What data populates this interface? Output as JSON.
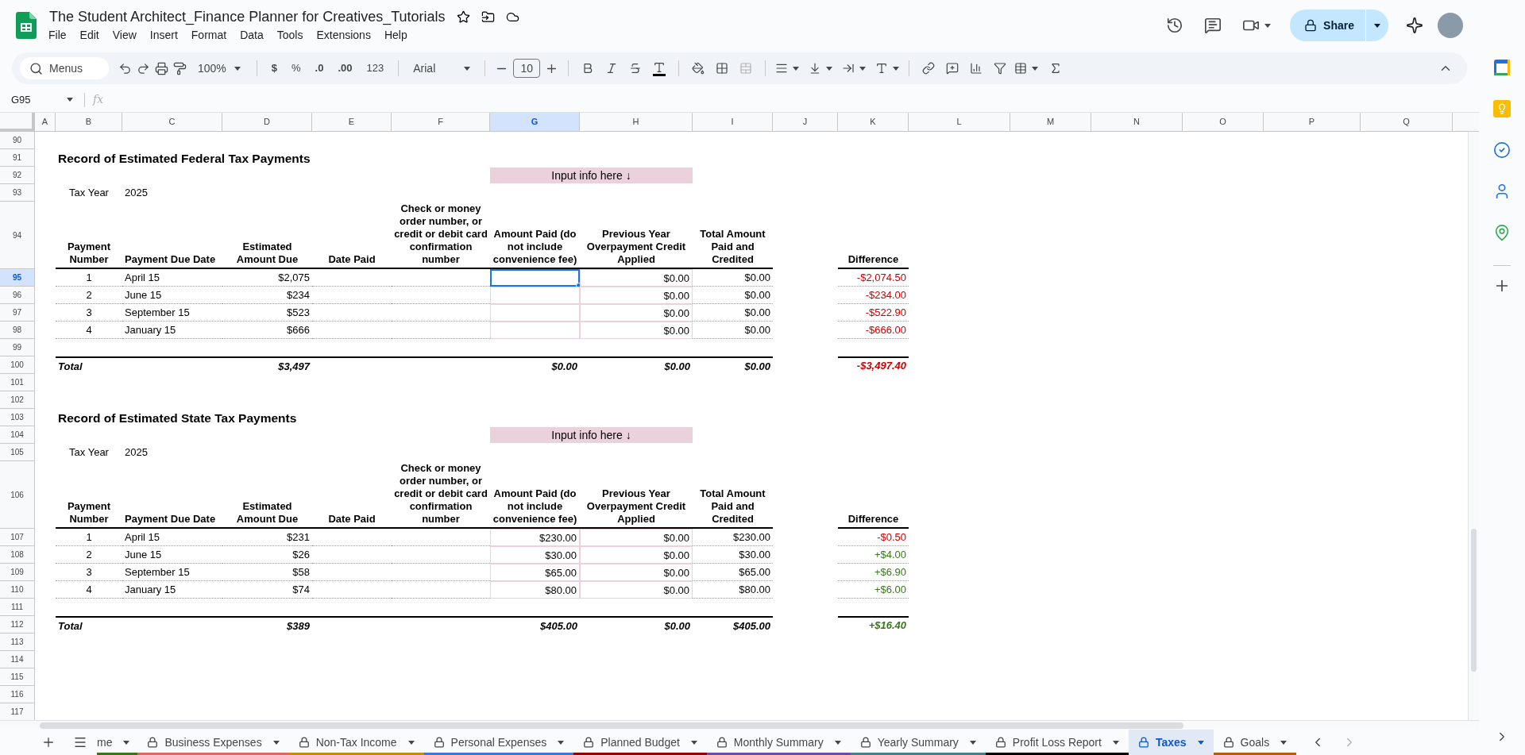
{
  "document": {
    "title": "The Student Architect_Finance Planner for Creatives_Tutorials",
    "menus": [
      "File",
      "Edit",
      "View",
      "Insert",
      "Format",
      "Data",
      "Tools",
      "Extensions",
      "Help"
    ]
  },
  "share_button": {
    "label": "Share"
  },
  "toolbar": {
    "search": "Menus",
    "zoom": "100%",
    "currency": "$",
    "percent": "%",
    "decrease_decimals": ".0",
    "increase_decimals": ".00",
    "number_format": "123",
    "font": "Arial",
    "font_size": "10"
  },
  "formula_bar": {
    "name_box": "G95",
    "function_label": "fx"
  },
  "columns": [
    {
      "label": "A",
      "selected": false
    },
    {
      "label": "B",
      "selected": false
    },
    {
      "label": "C",
      "selected": false
    },
    {
      "label": "D",
      "selected": false
    },
    {
      "label": "E",
      "selected": false
    },
    {
      "label": "F",
      "selected": false
    },
    {
      "label": "G",
      "selected": true
    },
    {
      "label": "H",
      "selected": false
    },
    {
      "label": "I",
      "selected": false
    },
    {
      "label": "J",
      "selected": false
    },
    {
      "label": "K",
      "selected": false
    },
    {
      "label": "L",
      "selected": false
    },
    {
      "label": "M",
      "selected": false
    },
    {
      "label": "N",
      "selected": false
    },
    {
      "label": "O",
      "selected": false
    },
    {
      "label": "P",
      "selected": false
    },
    {
      "label": "Q",
      "selected": false
    }
  ],
  "row_numbers": [
    {
      "label": "90",
      "selected": false
    },
    {
      "label": "91",
      "selected": false
    },
    {
      "label": "92",
      "selected": false
    },
    {
      "label": "93",
      "selected": false
    },
    {
      "label": "94",
      "selected": false
    },
    {
      "label": "95",
      "selected": true
    },
    {
      "label": "96",
      "selected": false
    },
    {
      "label": "97",
      "selected": false
    },
    {
      "label": "98",
      "selected": false
    },
    {
      "label": "99",
      "selected": false
    },
    {
      "label": "100",
      "selected": false
    },
    {
      "label": "101",
      "selected": false
    },
    {
      "label": "102",
      "selected": false
    },
    {
      "label": "103",
      "selected": false
    },
    {
      "label": "104",
      "selected": false
    },
    {
      "label": "105",
      "selected": false
    },
    {
      "label": "106",
      "selected": false
    },
    {
      "label": "107",
      "selected": false
    },
    {
      "label": "108",
      "selected": false
    },
    {
      "label": "109",
      "selected": false
    },
    {
      "label": "110",
      "selected": false
    },
    {
      "label": "111",
      "selected": false
    },
    {
      "label": "112",
      "selected": false
    },
    {
      "label": "113",
      "selected": false
    },
    {
      "label": "114",
      "selected": false
    },
    {
      "label": "115",
      "selected": false
    },
    {
      "label": "116",
      "selected": false
    },
    {
      "label": "117",
      "selected": false
    }
  ],
  "sections": [
    {
      "title": "Record of Estimated Federal Tax Payments",
      "input_banner": "Input info here ↓",
      "tax_year_label": "Tax Year",
      "tax_year": "2025",
      "headers": [
        "Payment Number",
        "Payment Due Date",
        "Estimated Amount Due",
        "Date Paid",
        "Check or money order number, or credit or debit card confirmation number",
        "Amount Paid (do not include convenience fee)",
        "Previous Year Overpayment Credit Applied",
        "Total Amount Paid and Credited",
        "Difference"
      ],
      "payments": [
        {
          "number": "1",
          "due_date": "April 15",
          "estimated": "$2,075",
          "prev_credit": "$0.00",
          "total": "$0.00",
          "difference": {
            "text": "-$2,074.50",
            "color": "#cc0000"
          },
          "selected": true
        },
        {
          "number": "2",
          "due_date": "June 15",
          "estimated": "$234",
          "prev_credit": "$0.00",
          "total": "$0.00",
          "difference": {
            "text": "-$234.00",
            "color": "#cc0000"
          },
          "selected": false
        },
        {
          "number": "3",
          "due_date": "September 15",
          "estimated": "$523",
          "prev_credit": "$0.00",
          "total": "$0.00",
          "difference": {
            "text": "-$522.90",
            "color": "#cc0000"
          },
          "selected": false
        },
        {
          "number": "4",
          "due_date": "January 15",
          "estimated": "$666",
          "prev_credit": "$0.00",
          "total": "$0.00",
          "difference": {
            "text": "-$666.00",
            "color": "#cc0000"
          },
          "selected": false
        }
      ],
      "total": {
        "label": "Total",
        "estimated": "$3,497",
        "amount_paid": "$0.00",
        "prev_credit": "$0.00",
        "total": "$0.00",
        "difference": {
          "text": "-$3,497.40",
          "color": "#cc0000"
        }
      }
    },
    {
      "title": "Record of Estimated State Tax Payments",
      "input_banner": "Input info here ↓",
      "tax_year_label": "Tax Year",
      "tax_year": "2025",
      "headers": [
        "Payment Number",
        "Payment Due Date",
        "Estimated Amount Due",
        "Date Paid",
        "Check or money order number, or credit or debit card confirmation number",
        "Amount Paid (do not include convenience fee)",
        "Previous Year Overpayment Credit Applied",
        "Total Amount Paid and Credited",
        "Difference"
      ],
      "payments": [
        {
          "number": "1",
          "due_date": "April 15",
          "estimated": "$231",
          "amount_paid": "$230.00",
          "prev_credit": "$0.00",
          "total": "$230.00",
          "difference": {
            "text": "-$0.50",
            "color": "#cc0000"
          },
          "selected": false
        },
        {
          "number": "2",
          "due_date": "June 15",
          "estimated": "$26",
          "amount_paid": "$30.00",
          "prev_credit": "$0.00",
          "total": "$30.00",
          "difference": {
            "text": "+$4.00",
            "color": "#38761d"
          },
          "selected": false
        },
        {
          "number": "3",
          "due_date": "September 15",
          "estimated": "$58",
          "amount_paid": "$65.00",
          "prev_credit": "$0.00",
          "total": "$65.00",
          "difference": {
            "text": "+$6.90",
            "color": "#38761d"
          },
          "selected": false
        },
        {
          "number": "4",
          "due_date": "January 15",
          "estimated": "$74",
          "amount_paid": "$80.00",
          "prev_credit": "$0.00",
          "total": "$80.00",
          "difference": {
            "text": "+$6.00",
            "color": "#38761d"
          },
          "selected": false
        }
      ],
      "total": {
        "label": "Total",
        "estimated": "$389",
        "amount_paid": "$405.00",
        "prev_credit": "$0.00",
        "total": "$405.00",
        "difference": {
          "text": "+$16.40",
          "color": "#38761d"
        }
      }
    }
  ],
  "tabs": [
    {
      "label": "me",
      "locked": false,
      "selected": false,
      "color": "#38761d"
    },
    {
      "label": "Business Expenses",
      "locked": true,
      "selected": false,
      "color": "#e06666"
    },
    {
      "label": "Non-Tax Income",
      "locked": true,
      "selected": false,
      "color": "#bf9000"
    },
    {
      "label": "Personal Expenses",
      "locked": true,
      "selected": false,
      "color": "#3c78d8"
    },
    {
      "label": "Planned Budget",
      "locked": true,
      "selected": false,
      "color": "#990000"
    },
    {
      "label": "Monthly Summary",
      "locked": true,
      "selected": false,
      "color": "#674ea7"
    },
    {
      "label": "Yearly Summary",
      "locked": true,
      "selected": false,
      "color": "#45818e"
    },
    {
      "label": "Profit Loss Report",
      "locked": true,
      "selected": false,
      "color": "#000000"
    },
    {
      "label": "Taxes",
      "locked": true,
      "selected": true
    },
    {
      "label": "Goals",
      "locked": true,
      "selected": false,
      "color": "#b45f06"
    }
  ]
}
